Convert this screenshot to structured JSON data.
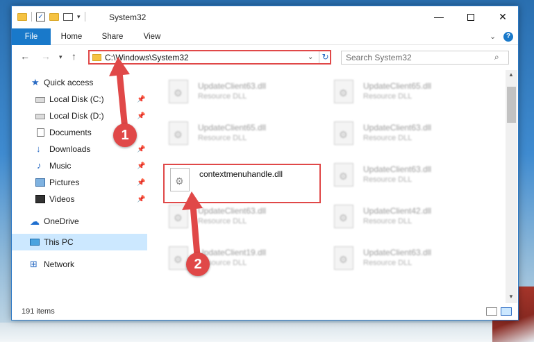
{
  "window": {
    "title": "System32",
    "controls": {
      "minimize": "—",
      "maximize": "",
      "close": "✕"
    }
  },
  "ribbon": {
    "tabs": [
      "File",
      "Home",
      "Share",
      "View"
    ],
    "help": "?"
  },
  "address_bar": {
    "path": "C:\\Windows\\System32",
    "search_placeholder": "Search System32"
  },
  "sidebar": {
    "items": [
      {
        "label": "Quick access",
        "icon": "star-icon",
        "pinned": false
      },
      {
        "label": "Local Disk (C:)",
        "icon": "disk-icon",
        "pinned": true
      },
      {
        "label": "Local Disk (D:)",
        "icon": "disk-icon",
        "pinned": true
      },
      {
        "label": "Documents",
        "icon": "documents-icon",
        "pinned": false
      },
      {
        "label": "Downloads",
        "icon": "downloads-icon",
        "pinned": true
      },
      {
        "label": "Music",
        "icon": "music-icon",
        "pinned": true
      },
      {
        "label": "Pictures",
        "icon": "pictures-icon",
        "pinned": true
      },
      {
        "label": "Videos",
        "icon": "videos-icon",
        "pinned": true
      },
      {
        "label": "OneDrive",
        "icon": "onedrive-icon",
        "pinned": false
      },
      {
        "label": "This PC",
        "icon": "this-pc-icon",
        "pinned": false,
        "selected": true
      },
      {
        "label": "Network",
        "icon": "network-icon",
        "pinned": false
      }
    ]
  },
  "files": [
    {
      "name": "UpdateClient63.dll",
      "type": "Resource DLL"
    },
    {
      "name": "UpdateClient65.dll",
      "type": "Resource DLL"
    },
    {
      "name": "UpdateClient65.dll",
      "type": "Resource DLL"
    },
    {
      "name": "UpdateClient63.dll",
      "type": "Resource DLL"
    },
    {
      "name": "contextmenuhandle.dll",
      "type": ""
    },
    {
      "name": "UpdateClient63.dll",
      "type": "Resource DLL"
    },
    {
      "name": "UpdateClient63.dll",
      "type": "Resource DLL"
    },
    {
      "name": "UpdateClient42.dll",
      "type": "Resource DLL"
    },
    {
      "name": "UpdateClient19.dll",
      "type": "Resource DLL"
    },
    {
      "name": "UpdateClient63.dll",
      "type": "Resource DLL"
    }
  ],
  "status": {
    "item_count": "191 items"
  },
  "annotations": {
    "step1": "1",
    "step2": "2",
    "color": "#e04848"
  }
}
